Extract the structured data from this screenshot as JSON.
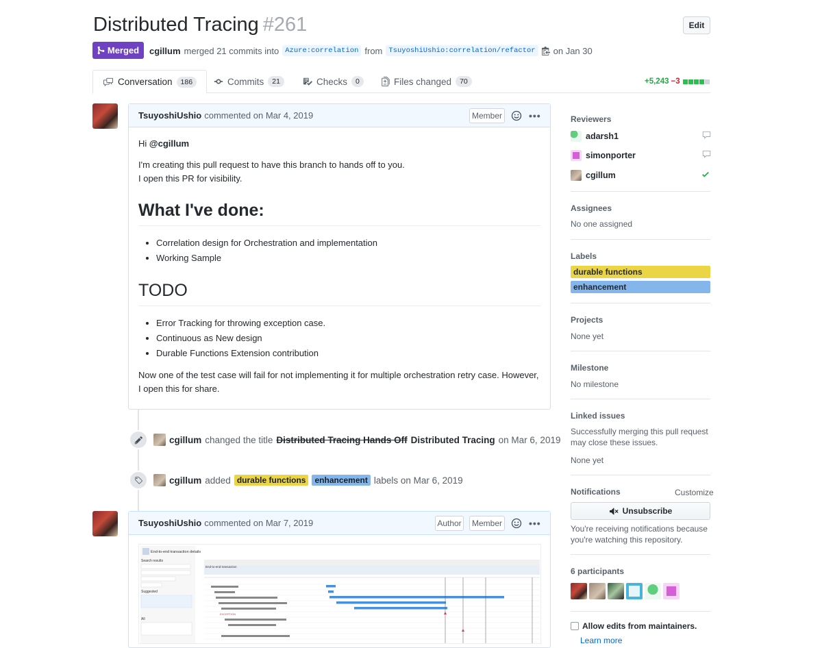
{
  "pr": {
    "title": "Distributed Tracing",
    "number": "#261",
    "edit_label": "Edit",
    "state_label": "Merged",
    "author": "cgillum",
    "merge_text": "merged 21 commits into",
    "base_branch": "Azure:correlation",
    "from_text": "from",
    "head_branch": "TsuyoshiUshio:correlation/refactor",
    "date_text": "on Jan 30"
  },
  "tabs": [
    {
      "label": "Conversation",
      "count": "186"
    },
    {
      "label": "Commits",
      "count": "21"
    },
    {
      "label": "Checks",
      "count": "0"
    },
    {
      "label": "Files changed",
      "count": "70"
    }
  ],
  "diffstat": {
    "additions": "+5,243",
    "deletions": "−3"
  },
  "comment1": {
    "author": "TsuyoshiUshio",
    "action": "commented on Mar 4, 2019",
    "role": "Member",
    "greeting_prefix": "Hi",
    "mention": "@cgillum",
    "para1_line1": "I'm creating this pull request to have this branch to hands off to you.",
    "para1_line2": "I open this PR for visibility.",
    "heading1": "What I've done:",
    "done_items": [
      "Correlation design for Orchestration and implementation",
      "Working Sample"
    ],
    "heading2": "TODO",
    "todo_items": [
      "Error Tracking for throwing exception case.",
      "Continuous as New design",
      "Durable Functions Extension contribution"
    ],
    "closing": "Now one of the test case will fail for not implementing it for multiple orchestration retry case. However, I open this for share."
  },
  "event1": {
    "user": "cgillum",
    "action": "changed the title",
    "old_title": "Distributed Tracing Hands Off",
    "new_title": "Distributed Tracing",
    "date": "on Mar 6, 2019"
  },
  "event2": {
    "user": "cgillum",
    "action": "added",
    "label1": "durable functions",
    "label2": "enhancement",
    "suffix": "labels on Mar 6, 2019"
  },
  "comment2": {
    "author": "TsuyoshiUshio",
    "action": "commented on Mar 7, 2019",
    "role1": "Author",
    "role2": "Member"
  },
  "screenshot": {
    "title": "End-to-end transaction details",
    "search_label": "Search results",
    "suggested_label": "Suggested",
    "all_label": "All",
    "txn_title": "End-to-end transaction",
    "exception_label": "EXCEPTION"
  },
  "sidebar": {
    "reviewers_heading": "Reviewers",
    "reviewers": [
      {
        "name": "adarsh1",
        "color": "#5fcf7e",
        "status": "comment"
      },
      {
        "name": "simonporter",
        "color": "#d45fd6",
        "status": "comment"
      },
      {
        "name": "cgillum",
        "color": "#9a8a7a",
        "status": "approved"
      }
    ],
    "assignees_heading": "Assignees",
    "assignees_text": "No one assigned",
    "labels_heading": "Labels",
    "labels": [
      {
        "name": "durable functions",
        "color": "#ecd544"
      },
      {
        "name": "enhancement",
        "color": "#84b6eb"
      }
    ],
    "projects_heading": "Projects",
    "projects_text": "None yet",
    "milestone_heading": "Milestone",
    "milestone_text": "No milestone",
    "linked_heading": "Linked issues",
    "linked_text1": "Successfully merging this pull request",
    "linked_text2": "may close these issues.",
    "linked_none": "None yet",
    "notifications_heading": "Notifications",
    "customize_label": "Customize",
    "unsubscribe_label": "Unsubscribe",
    "notif_text1": "You're receiving notifications because",
    "notif_text2": "you're watching this repository.",
    "participants_heading": "6 participants",
    "allow_edits_label": "Allow edits from maintainers.",
    "learn_more": "Learn more"
  }
}
